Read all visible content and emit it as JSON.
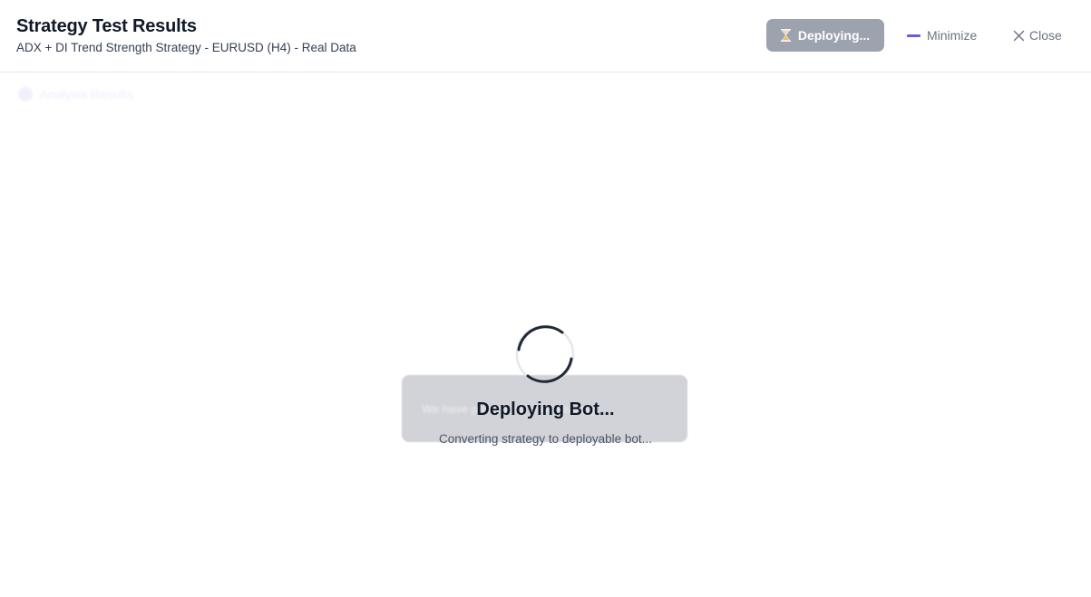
{
  "header": {
    "title": "Strategy Test Results",
    "subtitle": "ADX + DI Trend Strength Strategy - EURUSD (H4) - Real Data"
  },
  "actions": {
    "deploy_label": "Deploying...",
    "deploy_icon": "hourglass-icon",
    "deploy_state": "disabled",
    "minimize_label": "Minimize",
    "minimize_icon": "minimize-icon",
    "close_label": "Close",
    "close_icon": "close-icon"
  },
  "background": {
    "tab_label": "Analysis Results",
    "tab_icon": "chart-icon",
    "card_text": "We have processed your strategy"
  },
  "overlay": {
    "title": "Deploying Bot...",
    "message": "Converting strategy to deployable bot...",
    "spinner_icon": "spinner-icon"
  },
  "colors": {
    "deploy_button_bg": "#9ca3af",
    "minimize_accent": "#6d5fd3",
    "title_text": "#111827",
    "border": "#e5e7eb"
  }
}
